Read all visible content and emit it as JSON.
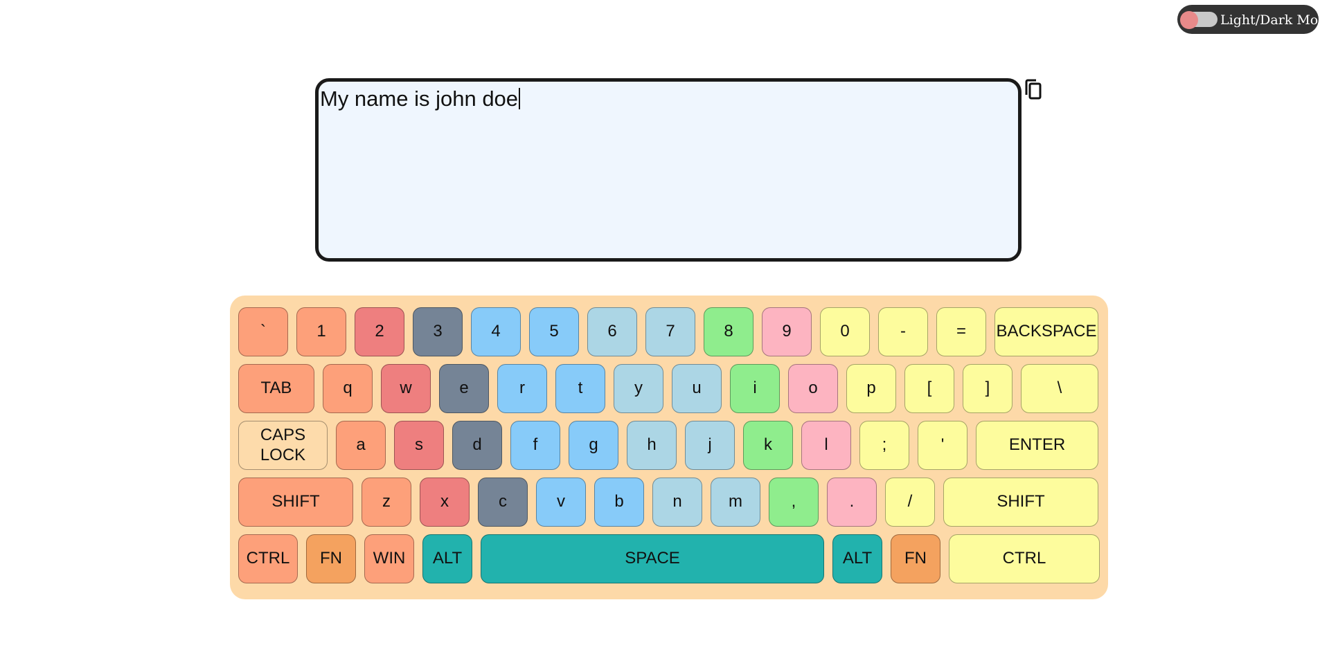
{
  "theme_toggle": {
    "label": "Light/Dark Mode"
  },
  "text_area": {
    "value": "My name is john doe"
  },
  "icons": {
    "copy": "copy-icon"
  },
  "colors": {
    "keyboard_bg": "#fdd9a8",
    "text_area_bg": "#eff6fe",
    "toggle_bg": "#333333"
  },
  "keyboard": {
    "rows": [
      [
        {
          "label": "`",
          "color": "#fda07a"
        },
        {
          "label": "1",
          "color": "#fda07a"
        },
        {
          "label": "2",
          "color": "#ee7f7f"
        },
        {
          "label": "3",
          "color": "#758496"
        },
        {
          "label": "4",
          "color": "#87cbf9"
        },
        {
          "label": "5",
          "color": "#87cbf9"
        },
        {
          "label": "6",
          "color": "#acd6e5"
        },
        {
          "label": "7",
          "color": "#acd6e5"
        },
        {
          "label": "8",
          "color": "#8fed8d"
        },
        {
          "label": "9",
          "color": "#fdb4c1"
        },
        {
          "label": "0",
          "color": "#fdfc9d"
        },
        {
          "label": "-",
          "color": "#fdfc9d"
        },
        {
          "label": "=",
          "color": "#fdfc9d"
        },
        {
          "label": "BACKSPACE",
          "color": "#fdfc9d"
        }
      ],
      [
        {
          "label": "TAB",
          "color": "#fda07a"
        },
        {
          "label": "q",
          "color": "#fda07a"
        },
        {
          "label": "w",
          "color": "#ee7f7f"
        },
        {
          "label": "e",
          "color": "#758496"
        },
        {
          "label": "r",
          "color": "#87cbf9"
        },
        {
          "label": "t",
          "color": "#87cbf9"
        },
        {
          "label": "y",
          "color": "#acd6e5"
        },
        {
          "label": "u",
          "color": "#acd6e5"
        },
        {
          "label": "i",
          "color": "#8fed8d"
        },
        {
          "label": "o",
          "color": "#fdb4c1"
        },
        {
          "label": "p",
          "color": "#fdfc9d"
        },
        {
          "label": "[",
          "color": "#fdfc9d"
        },
        {
          "label": "]",
          "color": "#fdfc9d"
        },
        {
          "label": "\\",
          "color": "#fdfc9d"
        }
      ],
      [
        {
          "label": "CAPS LOCK",
          "color": "#fddbab"
        },
        {
          "label": "a",
          "color": "#fda07a"
        },
        {
          "label": "s",
          "color": "#ee7f7f"
        },
        {
          "label": "d",
          "color": "#758496"
        },
        {
          "label": "f",
          "color": "#87cbf9"
        },
        {
          "label": "g",
          "color": "#87cbf9"
        },
        {
          "label": "h",
          "color": "#acd6e5"
        },
        {
          "label": "j",
          "color": "#acd6e5"
        },
        {
          "label": "k",
          "color": "#8fed8d"
        },
        {
          "label": "l",
          "color": "#fdb4c1"
        },
        {
          "label": ";",
          "color": "#fdfc9d"
        },
        {
          "label": "'",
          "color": "#fdfc9d"
        },
        {
          "label": "ENTER",
          "color": "#fdfc9d"
        }
      ],
      [
        {
          "label": "SHIFT",
          "color": "#fda07a"
        },
        {
          "label": "z",
          "color": "#fda07a"
        },
        {
          "label": "x",
          "color": "#ee7f7f"
        },
        {
          "label": "c",
          "color": "#758496"
        },
        {
          "label": "v",
          "color": "#87cbf9"
        },
        {
          "label": "b",
          "color": "#87cbf9"
        },
        {
          "label": "n",
          "color": "#acd6e5"
        },
        {
          "label": "m",
          "color": "#acd6e5"
        },
        {
          "label": ",",
          "color": "#8fed8d"
        },
        {
          "label": ".",
          "color": "#fdb4c1"
        },
        {
          "label": "/",
          "color": "#fdfc9d"
        },
        {
          "label": "SHIFT",
          "color": "#fdfc9d"
        }
      ],
      [
        {
          "label": "CTRL",
          "color": "#fda07a"
        },
        {
          "label": "FN",
          "color": "#f4a25f"
        },
        {
          "label": "WIN",
          "color": "#fda07a"
        },
        {
          "label": "ALT",
          "color": "#22b2ad"
        },
        {
          "label": "SPACE",
          "color": "#22b2ad"
        },
        {
          "label": "ALT",
          "color": "#22b2ad"
        },
        {
          "label": "FN",
          "color": "#f4a25f"
        },
        {
          "label": "CTRL",
          "color": "#fdfc9d"
        }
      ]
    ]
  }
}
